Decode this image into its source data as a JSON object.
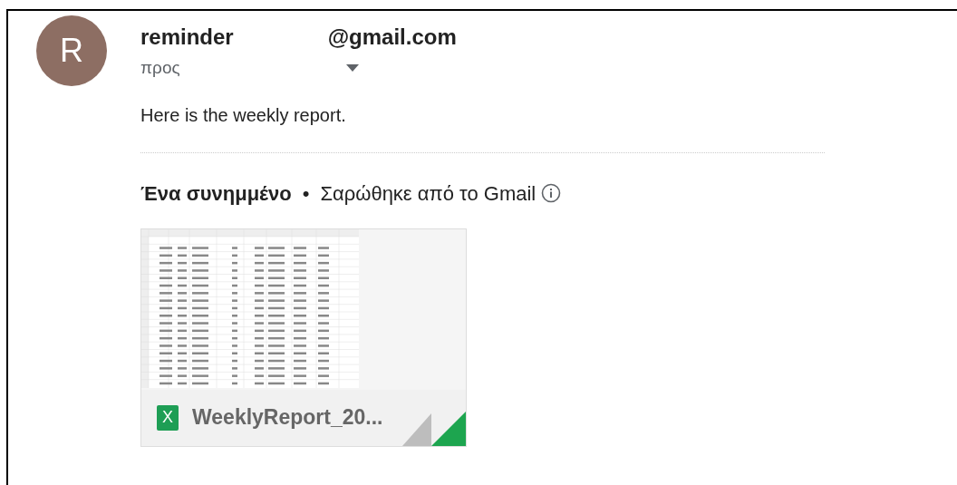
{
  "sender": {
    "avatar_letter": "R",
    "name": "reminder",
    "address": "@gmail.com"
  },
  "recipient": {
    "label": "προς"
  },
  "body": "Here is the weekly report.",
  "attachments": {
    "count_label": "Ένα συνημμένο",
    "separator": "•",
    "scan_note": "Σαρώθηκε από το Gmail",
    "files": [
      {
        "kind": "spreadsheet",
        "icon_letter": "X",
        "name": "WeeklyReport_20..."
      }
    ]
  }
}
